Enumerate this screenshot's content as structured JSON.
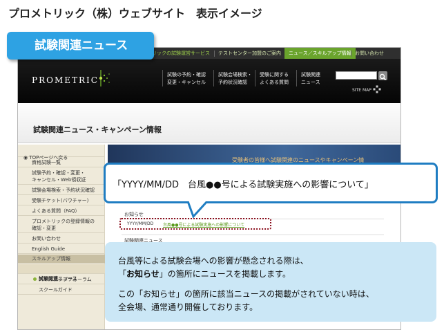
{
  "page_title": "プロメトリック（株）ウェブサイト　表示イメージ",
  "tag_label": "試験関連ニュース",
  "topnav": {
    "items": [
      "リックの試験運営サービス",
      "テストセンター加盟のご案内",
      "ニュース／スキルアップ情報",
      "お問い合わせ"
    ]
  },
  "header": {
    "logo_text": "PROMETRIC",
    "links": [
      "試験の予約・確認\n変更・キャンセル",
      "試験会場検索・\n予約状況確認",
      "受験に関する\nよくある質問",
      "試験関連\nニュース"
    ],
    "sitemap": "SITE MAP"
  },
  "content_title": "試験関連ニュース・キャンペーン情報",
  "sidebar": {
    "top_item": "TOPページへ戻る",
    "items": [
      "資格試験一覧",
      "試験予約・確認・変更・\nキャンセル・Web領収証",
      "試験会場検索・予約状況確認",
      "受験チケット(バウチャー)",
      "よくある質問（FAQ）",
      "プロメトリックの登録情報の\n確認・変更",
      "お問い合わせ",
      "English Guide"
    ],
    "section": "スキルアップ情報",
    "active": "試験関連ニュース",
    "subs": [
      "スキルアップフォーラム",
      "スクールガイド"
    ]
  },
  "hero_text": "受験者の皆様へ試験関連のニュースやキャンペーン情",
  "oshirase_label": "お知らせ",
  "news": {
    "date": "YYYY/MM/DD",
    "link": "台風●●号による試験実施への影響について"
  },
  "related_label": "試験関連ニュース",
  "callout": "「YYYY/MM/DD　台風●●号による試験実施への影響について」",
  "note": {
    "line1": "台風等による試験会場への影響が懸念される際は、",
    "line2_prefix": "「",
    "line2_bold": "お知らせ",
    "line2_suffix": "」の箇所にニュースを掲載します。",
    "line3": "この「お知らせ」の箇所に該当ニュースの掲載がされていない時は、",
    "line4": "全会場、通常通り開催しております。"
  },
  "colors": {
    "accent_blue": "#2ea2e3",
    "callout_border": "#1f7dc2",
    "note_bg": "#cbe7f6",
    "highlight": "#8b0f1e",
    "nav_green": "#6aa42c"
  }
}
